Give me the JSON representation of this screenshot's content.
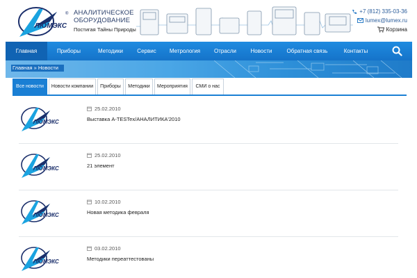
{
  "brand": {
    "name": "ЛЮМЭКС",
    "registered": "®",
    "tagline_line1": "АНАЛИТИЧЕСКОЕ",
    "tagline_line2": "ОБОРУДОВАНИЕ",
    "slogan": "Постигая Тайны Природы"
  },
  "contacts": {
    "phone": "+7 (812) 335-03-36",
    "email": "lumex@lumex.ru",
    "cart": "Корзина"
  },
  "nav": {
    "items": [
      {
        "label": "Главная"
      },
      {
        "label": "Приборы"
      },
      {
        "label": "Методики"
      },
      {
        "label": "Сервис"
      },
      {
        "label": "Метрология"
      },
      {
        "label": "Отрасли"
      },
      {
        "label": "Новости"
      },
      {
        "label": "Обратная связь"
      },
      {
        "label": "Контакты"
      }
    ],
    "search_icon": "search-icon"
  },
  "breadcrumb": {
    "text": "Главная » Новости"
  },
  "tabs": [
    {
      "label": "Все новости",
      "active": true
    },
    {
      "label": "Новости компании",
      "active": false
    },
    {
      "label": "Приборы",
      "active": false
    },
    {
      "label": "Методики",
      "active": false
    },
    {
      "label": "Мероприятия",
      "active": false
    },
    {
      "label": "СМИ о нас",
      "active": false
    }
  ],
  "news": [
    {
      "date": "25.02.2010",
      "title": "Выставка A-TESTex/АНАЛИТИКА'2010"
    },
    {
      "date": "25.02.2010",
      "title": "21 элемент"
    },
    {
      "date": "10.02.2010",
      "title": "Новая методика февраля"
    },
    {
      "date": "03.02.2010",
      "title": "Методики переаттестованы"
    }
  ],
  "colors": {
    "nav_blue": "#1a7fd4",
    "brand_navy": "#1b2f6b",
    "brand_cyan": "#1aa3e0"
  }
}
